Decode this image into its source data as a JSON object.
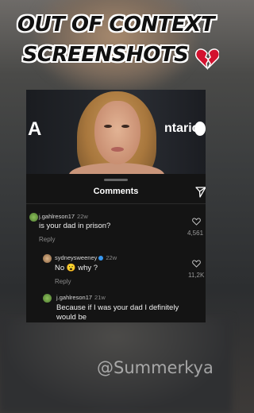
{
  "headline": {
    "line1": "OUT OF CONTEXT",
    "line2": "SCREENSHOTS",
    "emoji_icon": "broken-heart-icon"
  },
  "photo": {
    "left_sign_text": "A",
    "right_sign_text": "ntario"
  },
  "comments_panel": {
    "title": "Comments",
    "share_icon": "send-icon",
    "comments": [
      {
        "username": "j.gahlreson17",
        "time": "22w",
        "text": "is your dad in prison?",
        "reply_label": "Reply",
        "likes": "4,561"
      },
      {
        "username": "sydneysweeney",
        "verified": true,
        "time": "22w",
        "text": "No 😮 why ?",
        "reply_label": "Reply",
        "likes": "11,2K"
      },
      {
        "username": "j.gahlreson17",
        "time": "21w",
        "text": "Because if I was your dad I definitely would be"
      }
    ]
  },
  "watermark": "@Summerkya",
  "colors": {
    "panel_bg": "#141414",
    "verified_blue": "#3797f0",
    "heart_red": "#d3122f"
  }
}
